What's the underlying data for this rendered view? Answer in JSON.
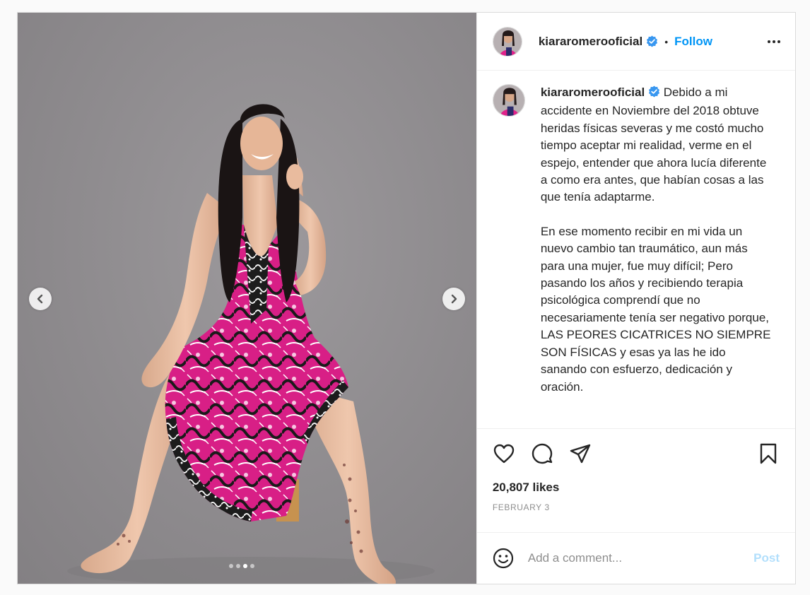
{
  "post": {
    "username": "kiararomerooficial",
    "separator": "•",
    "follow_label": "Follow",
    "caption_paragraphs": [
      "Debido a mi accidente en Noviembre del 2018 obtuve heridas físicas severas y me costó mucho tiempo aceptar mi realidad, verme en el espejo, entender que ahora lucía diferente a como era antes, que habían cosas a las que tenía adaptarme.",
      "En ese momento recibir en mi vida un nuevo cambio tan traumático, aun más para una mujer, fue muy difícil; Pero pasando los años y recibiendo terapia psicológica comprendí que no necesariamente tenía ser negativo porque, LAS PEORES CICATRICES NO SIEMPRE SON FÍSICAS y esas ya las he ido sanando con esfuerzo, dedicación y oración."
    ],
    "likes": "20,807 likes",
    "date": "FEBRUARY 3"
  },
  "comment": {
    "placeholder": "Add a comment...",
    "post_label": "Post"
  },
  "carousel": {
    "slide_count": 4,
    "active_index": 2
  },
  "icons": {
    "more": "more-options-icon",
    "like": "heart-icon",
    "comment": "comment-icon",
    "share": "share-icon",
    "save": "bookmark-icon",
    "emoji": "emoji-icon",
    "verified": "verified-badge-icon",
    "prev": "chevron-left-icon",
    "next": "chevron-right-icon"
  },
  "colors": {
    "accent": "#0095f6",
    "verified": "#3897f0",
    "post_disabled": "#b2dffc",
    "dress_pink": "#e0218a"
  }
}
